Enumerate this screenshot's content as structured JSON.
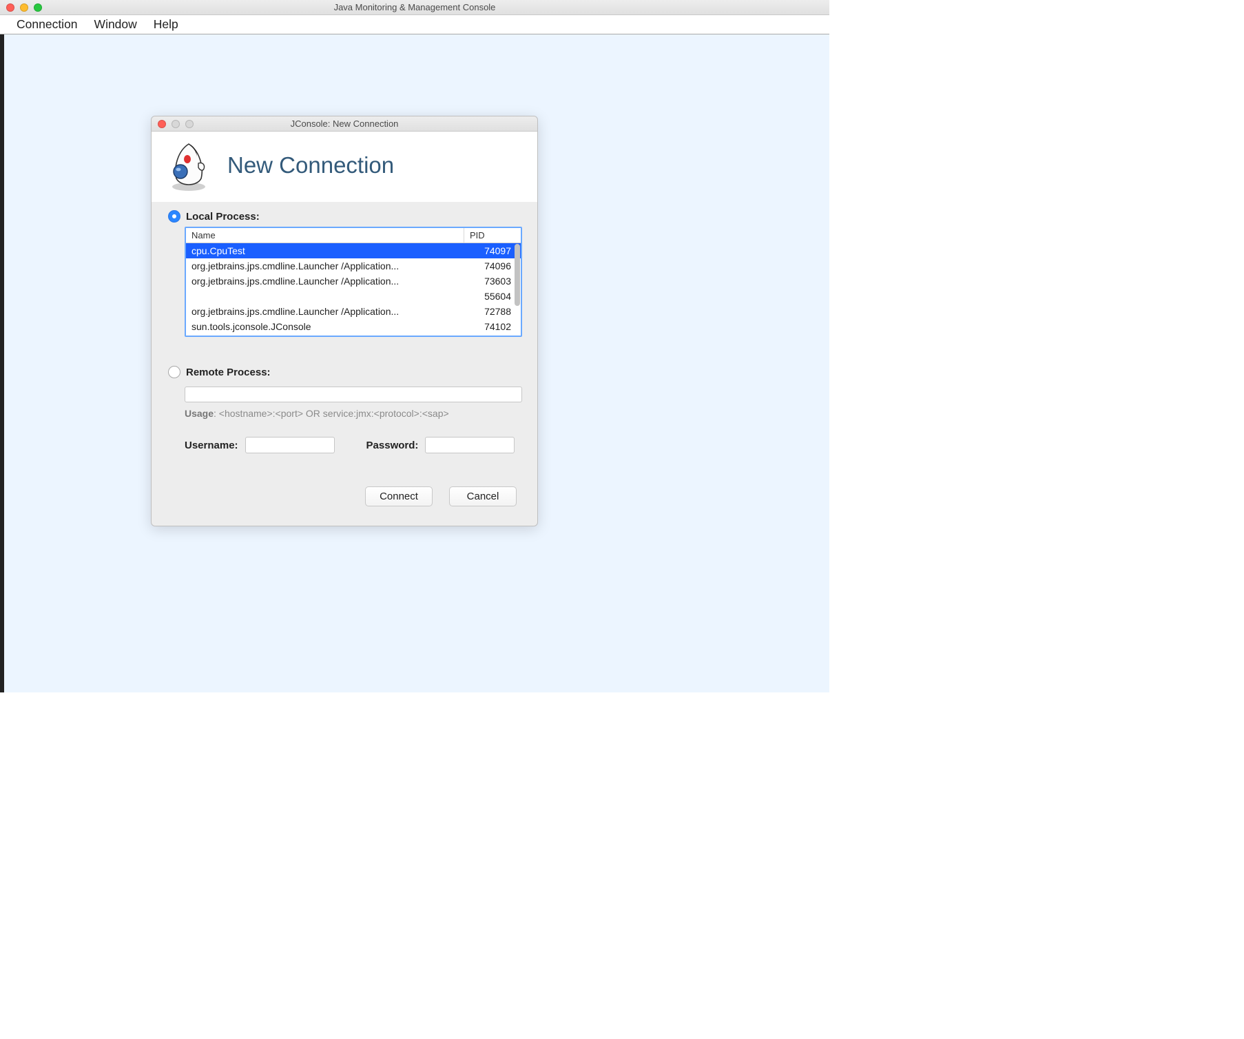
{
  "main_window": {
    "title": "Java Monitoring & Management Console",
    "menubar": [
      "Connection",
      "Window",
      "Help"
    ]
  },
  "dialog": {
    "title": "JConsole: New Connection",
    "heading": "New Connection",
    "local_process": {
      "label": "Local Process:",
      "selected": true,
      "columns": {
        "name": "Name",
        "pid": "PID"
      },
      "rows": [
        {
          "name": "cpu.CpuTest",
          "pid": "74097",
          "selected": true
        },
        {
          "name": "org.jetbrains.jps.cmdline.Launcher /Application...",
          "pid": "74096",
          "selected": false
        },
        {
          "name": "org.jetbrains.jps.cmdline.Launcher /Application...",
          "pid": "73603",
          "selected": false
        },
        {
          "name": "",
          "pid": "55604",
          "selected": false
        },
        {
          "name": "org.jetbrains.jps.cmdline.Launcher /Application...",
          "pid": "72788",
          "selected": false
        },
        {
          "name": "sun.tools.jconsole.JConsole",
          "pid": "74102",
          "selected": false
        }
      ]
    },
    "remote_process": {
      "label": "Remote Process:",
      "selected": false,
      "value": "",
      "usage_label": "Usage",
      "usage_hint": ": <hostname>:<port> OR service:jmx:<protocol>:<sap>"
    },
    "credentials": {
      "username_label": "Username:",
      "username_value": "",
      "password_label": "Password:",
      "password_value": ""
    },
    "buttons": {
      "connect": "Connect",
      "cancel": "Cancel"
    }
  }
}
